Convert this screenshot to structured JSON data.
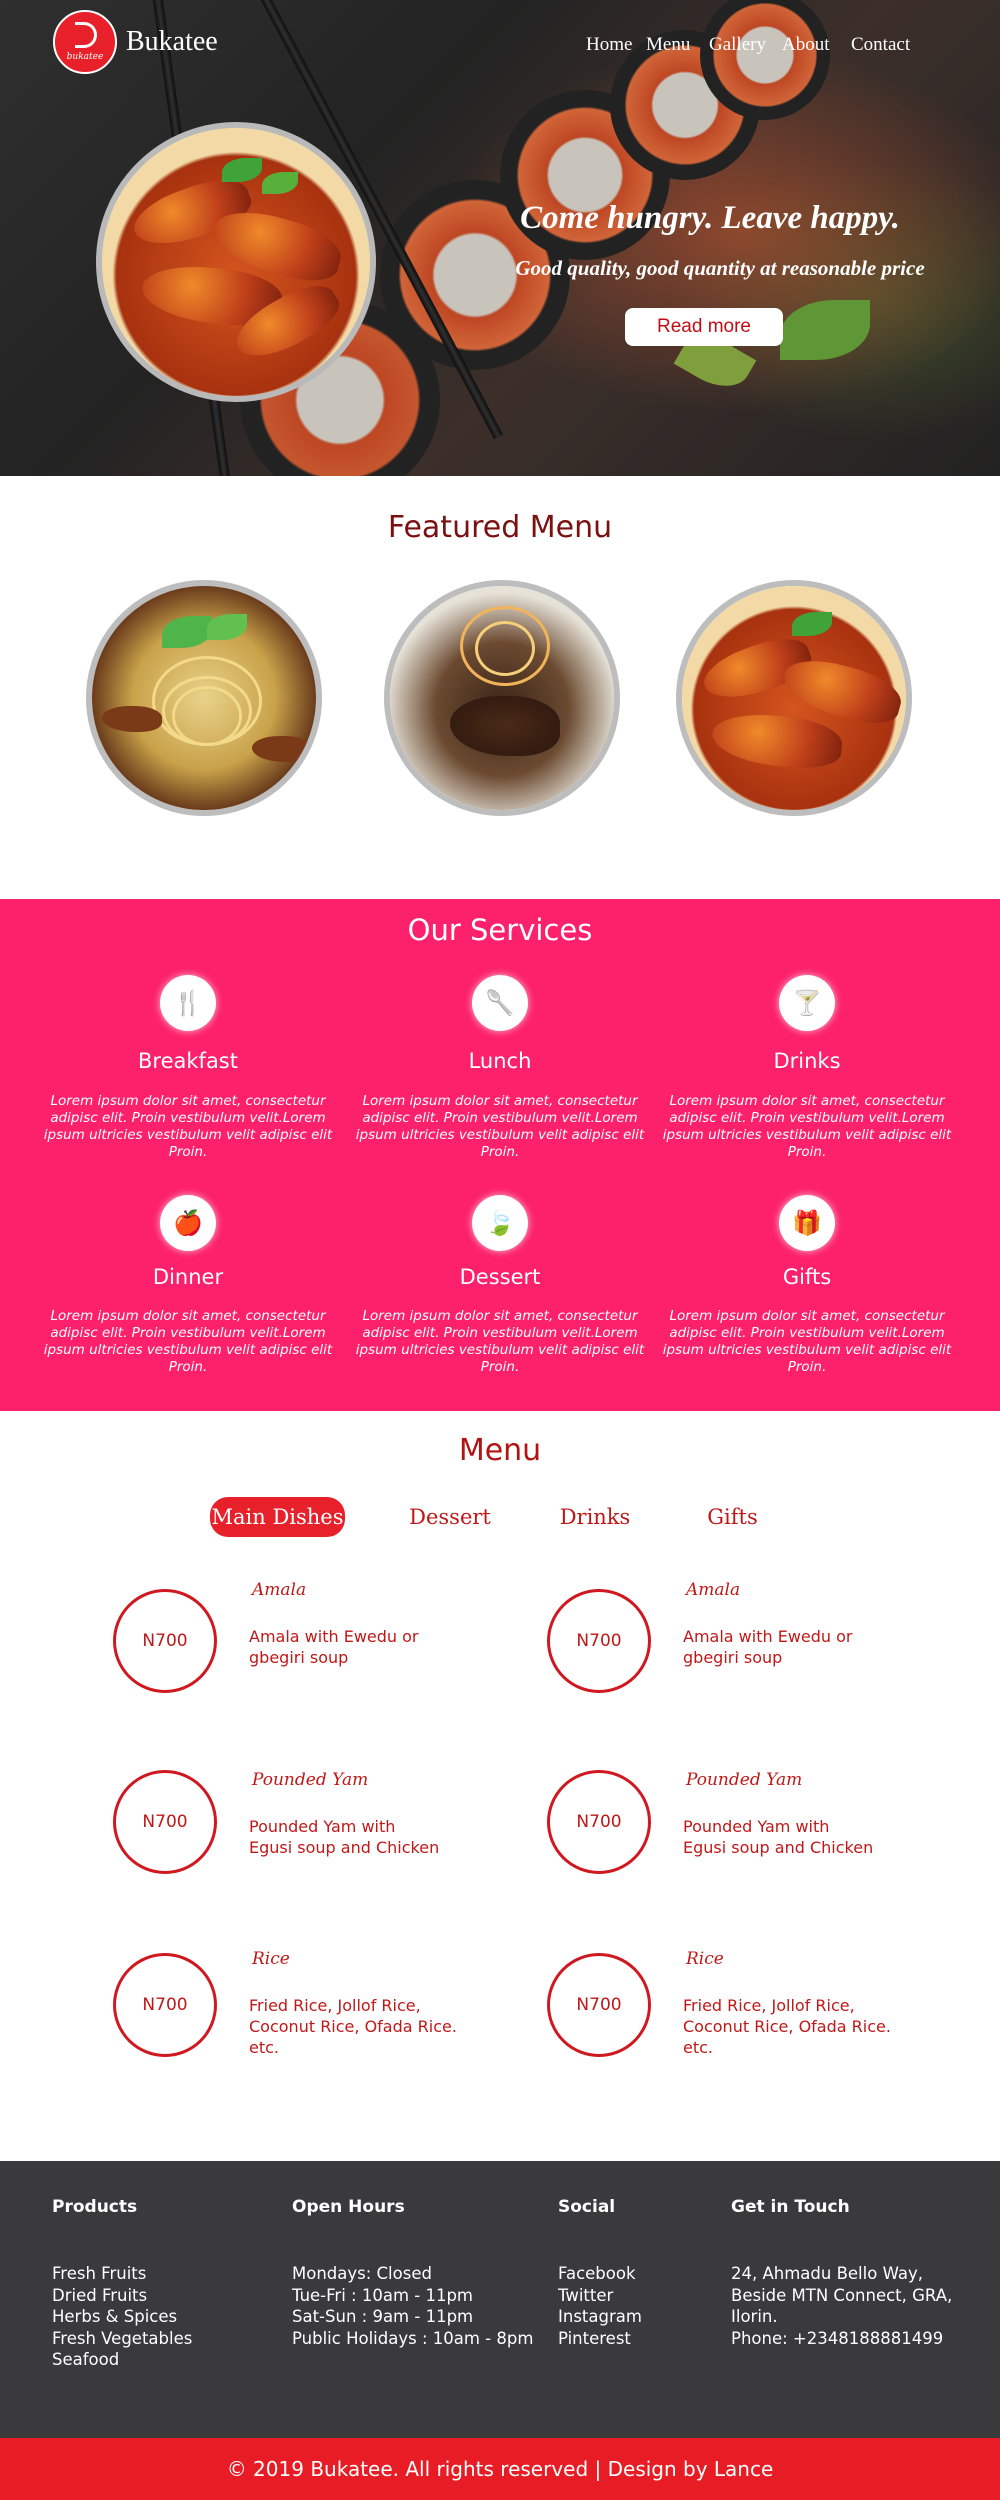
{
  "header": {
    "logo_text": "bukatee",
    "brand": "Bukatee",
    "nav": [
      "Home",
      "Menu",
      "Gallery",
      "About",
      "Contact"
    ]
  },
  "hero": {
    "title": "Come hungry. Leave happy.",
    "subtitle": "Good quality, good quantity at reasonable price",
    "button": "Read more"
  },
  "featured": {
    "title": "Featured Menu"
  },
  "services": {
    "title": "Our Services",
    "items": [
      {
        "name": "Breakfast",
        "icon": "cutlery-icon",
        "glyph": "🍴",
        "text": "Lorem ipsum dolor sit amet, consectetur adipisc elit. Proin vestibulum velit.Lorem ipsum ultricies vestibulum velit adipisc elit Proin."
      },
      {
        "name": "Lunch",
        "icon": "spoon-icon",
        "glyph": "🥄",
        "text": "Lorem ipsum dolor sit amet, consectetur adipisc elit. Proin vestibulum velit.Lorem ipsum ultricies vestibulum velit adipisc elit Proin."
      },
      {
        "name": "Drinks",
        "icon": "cocktail-icon",
        "glyph": "🍸",
        "text": "Lorem ipsum dolor sit amet, consectetur adipisc elit. Proin vestibulum velit.Lorem ipsum ultricies vestibulum velit adipisc elit Proin."
      },
      {
        "name": "Dinner",
        "icon": "apple-icon",
        "glyph": "🍎",
        "text": "Lorem ipsum dolor sit amet, consectetur adipisc elit. Proin vestibulum velit.Lorem ipsum ultricies vestibulum velit adipisc elit Proin."
      },
      {
        "name": "Dessert",
        "icon": "leaf-icon",
        "glyph": "🍃",
        "text": "Lorem ipsum dolor sit amet, consectetur adipisc elit. Proin vestibulum velit.Lorem ipsum ultricies vestibulum velit adipisc elit Proin."
      },
      {
        "name": "Gifts",
        "icon": "gift-icon",
        "glyph": "🎁",
        "text": "Lorem ipsum dolor sit amet, consectetur adipisc elit. Proin vestibulum velit.Lorem ipsum ultricies vestibulum velit adipisc elit Proin."
      }
    ]
  },
  "menu": {
    "title": "Menu",
    "tabs": [
      "Main Dishes",
      "Dessert",
      "Drinks",
      "Gifts"
    ],
    "active_tab": "Main Dishes",
    "items": [
      {
        "price": "N700",
        "name": "Amala",
        "desc_line1": "Amala with Ewedu or",
        "desc_line2": "gbegiri soup",
        "desc_line3": ""
      },
      {
        "price": "N700",
        "name": "Amala",
        "desc_line1": "Amala with Ewedu or",
        "desc_line2": "gbegiri soup",
        "desc_line3": ""
      },
      {
        "price": "N700",
        "name": "Pounded Yam",
        "desc_line1": "Pounded Yam with",
        "desc_line2": "Egusi soup and Chicken",
        "desc_line3": ""
      },
      {
        "price": "N700",
        "name": "Pounded Yam",
        "desc_line1": "Pounded Yam with",
        "desc_line2": "Egusi soup and Chicken",
        "desc_line3": ""
      },
      {
        "price": "N700",
        "name": "Rice",
        "desc_line1": "Fried Rice, Jollof Rice,",
        "desc_line2": "Coconut Rice, Ofada Rice.",
        "desc_line3": "etc."
      },
      {
        "price": "N700",
        "name": "Rice",
        "desc_line1": "Fried Rice, Jollof Rice,",
        "desc_line2": "Coconut Rice, Ofada Rice.",
        "desc_line3": "etc."
      }
    ]
  },
  "footer": {
    "products": {
      "title": "Products",
      "items": [
        "Fresh Fruits",
        "Dried Fruits",
        "Herbs & Spices",
        "Fresh Vegetables",
        "Seafood"
      ]
    },
    "hours": {
      "title": "Open Hours",
      "items": [
        "Mondays: Closed",
        "Tue-Fri : 10am - 11pm",
        "Sat-Sun : 9am - 11pm",
        "Public Holidays : 10am - 8pm"
      ]
    },
    "social": {
      "title": "Social",
      "items": [
        "Facebook",
        "Twitter",
        "Instagram",
        "Pinterest"
      ]
    },
    "contact": {
      "title": "Get in Touch",
      "items": [
        "24, Ahmadu Bello Way,",
        "Beside MTN Connect, GRA,",
        "Ilorin.",
        "Phone: +2348188881499"
      ]
    },
    "copyright": "© 2019 Bukatee. All rights reserved | Design by Lance"
  },
  "colors": {
    "accent": "#e8202a",
    "services_bg": "#fd206a",
    "footer_bg": "#3a3a3c",
    "heading": "#7b1010"
  }
}
